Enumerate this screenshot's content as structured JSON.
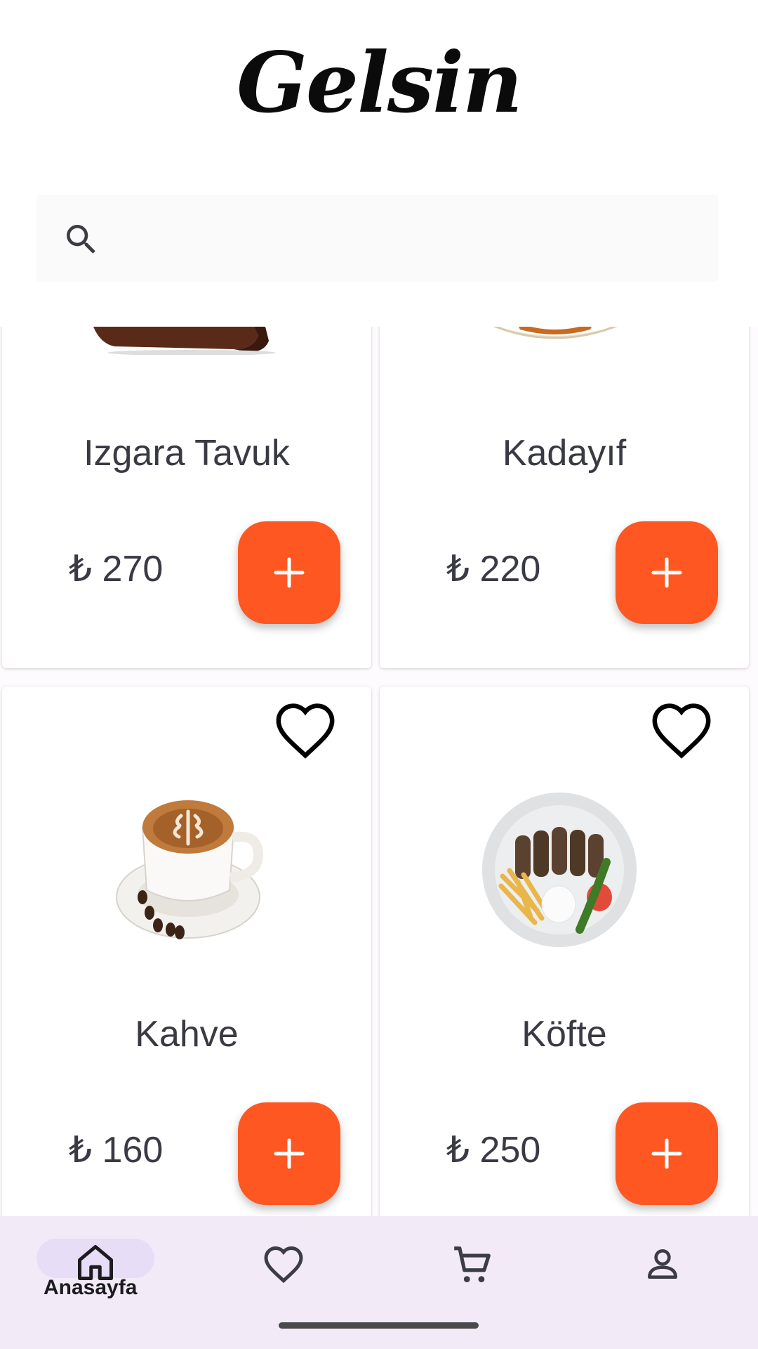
{
  "app": {
    "logo": "Gelsin"
  },
  "search": {
    "placeholder": ""
  },
  "products": [
    {
      "name": "Izgara Tavuk",
      "price": "₺ 270",
      "image": "grilled-chicken-board",
      "favorite": false
    },
    {
      "name": "Kadayıf",
      "price": "₺ 220",
      "image": "kadayif-plate",
      "favorite": false
    },
    {
      "name": "Kahve",
      "price": "₺ 160",
      "image": "coffee-cup",
      "favorite": false
    },
    {
      "name": "Köfte",
      "price": "₺ 250",
      "image": "kofte-plate",
      "favorite": false
    }
  ],
  "nav": {
    "items": [
      {
        "label": "Anasayfa",
        "icon": "home-icon",
        "active": true
      },
      {
        "label": "",
        "icon": "heart-icon",
        "active": false
      },
      {
        "label": "",
        "icon": "cart-icon",
        "active": false
      },
      {
        "label": "",
        "icon": "profile-icon",
        "active": false
      }
    ]
  },
  "colors": {
    "accent": "#ff5722",
    "nav_bg": "#f2ebf7",
    "nav_active": "#e7ddf7"
  }
}
